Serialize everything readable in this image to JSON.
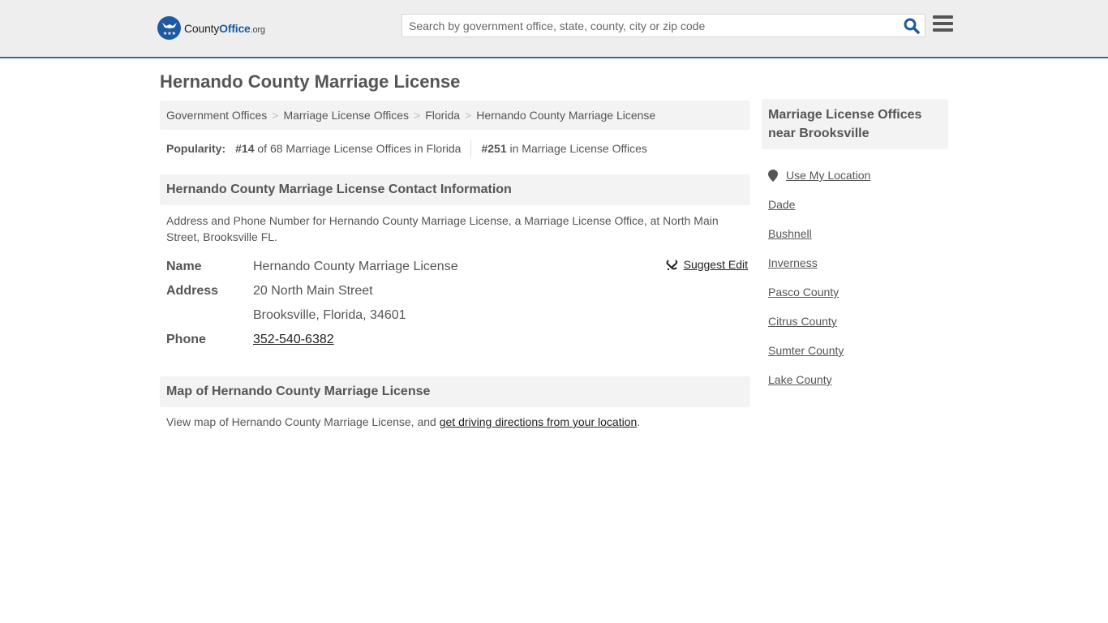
{
  "header": {
    "logo": {
      "county": "County",
      "office": "Office",
      "org": ".org"
    },
    "search": {
      "placeholder": "Search by government office, state, county, city or zip code",
      "value": ""
    },
    "icons": {
      "search": "search-icon",
      "menu": "hamburger-menu-icon"
    }
  },
  "page": {
    "title": "Hernando County Marriage License"
  },
  "breadcrumb": [
    "Government Offices",
    "Marriage License Offices",
    "Florida",
    "Hernando County Marriage License"
  ],
  "breadcrumb_separator": ">",
  "popularity": {
    "label": "Popularity:",
    "state_rank": "#14",
    "state_rank_text": "of 68 Marriage License Offices in Florida",
    "national_rank": "#251",
    "national_rank_text": "in Marriage License Offices"
  },
  "contact": {
    "heading": "Hernando County Marriage License Contact Information",
    "description": "Address and Phone Number for Hernando County Marriage License, a Marriage License Office, at North Main Street, Brooksville FL.",
    "suggest_edit": "Suggest Edit",
    "fields": {
      "name_label": "Name",
      "name_value": "Hernando County Marriage License",
      "address_label": "Address",
      "address_line1": "20 North Main Street",
      "address_line2": "Brooksville, Florida, 34601",
      "phone_label": "Phone",
      "phone_value": "352-540-6382"
    }
  },
  "map": {
    "heading": "Map of Hernando County Marriage License",
    "text_prefix": "View map of Hernando County Marriage License, and ",
    "link": "get driving directions from your location",
    "text_suffix": "."
  },
  "sidebar": {
    "heading": "Marriage License Offices near Brooksville",
    "use_location": "Use My Location",
    "items": [
      "Dade",
      "Bushnell",
      "Inverness",
      "Pasco County",
      "Citrus County",
      "Sumter County",
      "Lake County"
    ]
  },
  "colors": {
    "brand_blue": "#1d5aa1",
    "header_border": "#2f6aa8",
    "header_bg": "#eeeeee",
    "panel_bg": "#f3f3f3",
    "text": "#555555"
  }
}
